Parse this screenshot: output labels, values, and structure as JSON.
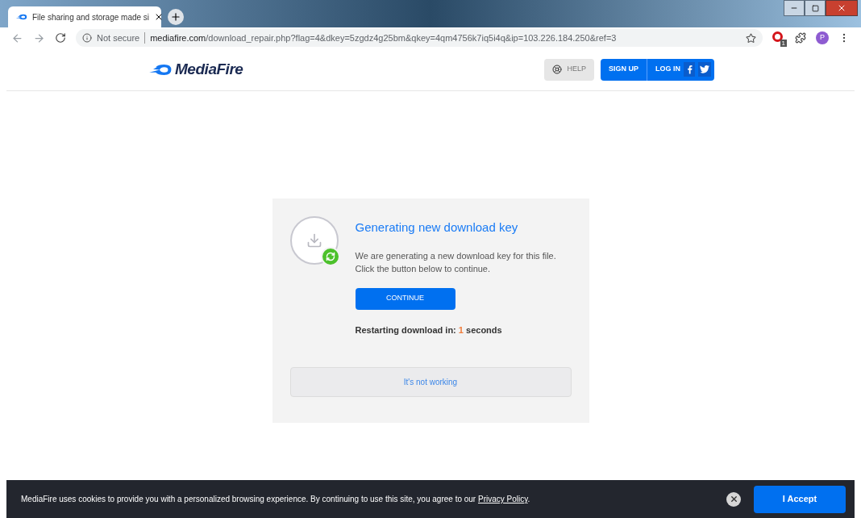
{
  "browser": {
    "tab": {
      "title": "File sharing and storage made si",
      "selected": true
    },
    "security": "Not secure",
    "url_host": "mediafire.com",
    "url_path": "/download_repair.php?flag=4&dkey=5zgdz4g25bm&qkey=4qm4756k7iq5i4q&ip=103.226.184.250&ref=3",
    "extension_badge": "1",
    "profile_initial": "P"
  },
  "header": {
    "logo": "MediaFire",
    "help": "HELP",
    "signup": "SIGN UP",
    "login": "LOG IN"
  },
  "card": {
    "title": "Generating new download key",
    "body": "We are generating a new download key for this file. Click the button below to continue.",
    "button": "CONTINUE",
    "countdown_prefix": "Restarting download in: ",
    "countdown_value": "1",
    "countdown_suffix": " seconds",
    "help_link": "It's not working"
  },
  "cookie_bar": {
    "text": "MediaFire uses cookies to provide you with a personalized browsing experience. By continuing to use this site, you agree to our ",
    "link": "Privacy Policy",
    "text_end": ".",
    "accept": "I Accept"
  }
}
